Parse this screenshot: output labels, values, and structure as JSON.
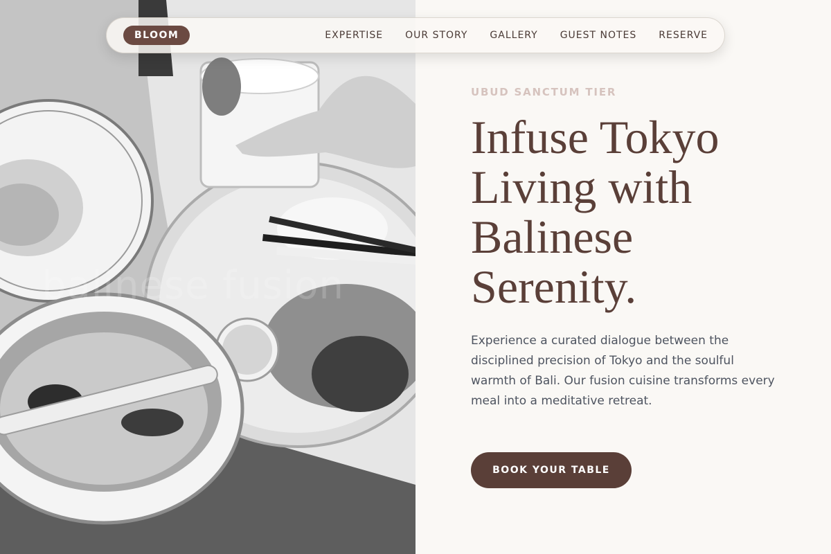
{
  "nav": {
    "brand": "BLOOM",
    "links": [
      {
        "label": "EXPERTISE"
      },
      {
        "label": "OUR STORY"
      },
      {
        "label": "GALLERY"
      },
      {
        "label": "GUEST NOTES"
      },
      {
        "label": "RESERVE"
      }
    ]
  },
  "hero": {
    "eyebrow": "UBUD SANCTUM TIER",
    "headline": "Infuse Tokyo Living with Balinese Serenity.",
    "description": "Experience a curated dialogue between the disciplined precision of Tokyo and the soulful warmth of Bali. Our fusion cuisine transforms every meal into a meditative retreat.",
    "cta_label": "BOOK YOUR TABLE",
    "image_watermark": "balinese fusion"
  },
  "colors": {
    "accent": "#5a3f38",
    "brand_pill": "#6b4a42",
    "eyebrow": "#d6c3be",
    "background": "#faf8f5",
    "body_text": "#4e5460"
  }
}
